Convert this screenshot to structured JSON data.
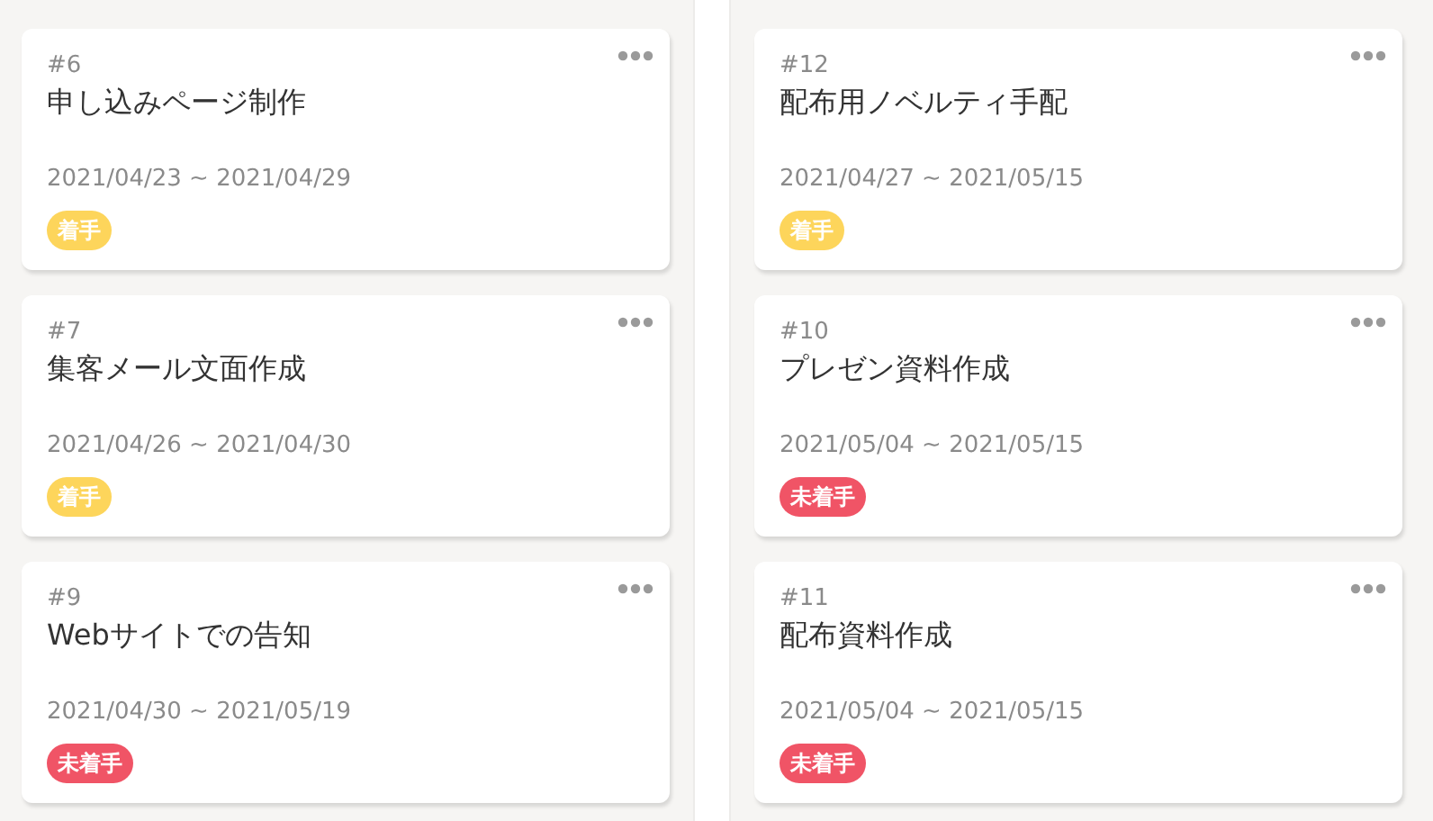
{
  "columns": [
    {
      "cards": [
        {
          "number": "#6",
          "title": "申し込みページ制作",
          "dates": "2021/04/23 ~ 2021/04/29",
          "status": {
            "label": "着手",
            "color": "#fdd55b"
          }
        },
        {
          "number": "#7",
          "title": "集客メール文面作成",
          "dates": "2021/04/26 ~ 2021/04/30",
          "status": {
            "label": "着手",
            "color": "#fdd55b"
          }
        },
        {
          "number": "#9",
          "title": "Webサイトでの告知",
          "dates": "2021/04/30 ~ 2021/05/19",
          "status": {
            "label": "未着手",
            "color": "#f05466"
          }
        }
      ]
    },
    {
      "cards": [
        {
          "number": "#12",
          "title": "配布用ノベルティ手配",
          "dates": "2021/04/27 ~ 2021/05/15",
          "status": {
            "label": "着手",
            "color": "#fdd55b"
          }
        },
        {
          "number": "#10",
          "title": "プレゼン資料作成",
          "dates": "2021/05/04 ~ 2021/05/15",
          "status": {
            "label": "未着手",
            "color": "#f05466"
          }
        },
        {
          "number": "#11",
          "title": "配布資料作成",
          "dates": "2021/05/04 ~ 2021/05/15",
          "status": {
            "label": "未着手",
            "color": "#f05466"
          }
        }
      ]
    }
  ]
}
